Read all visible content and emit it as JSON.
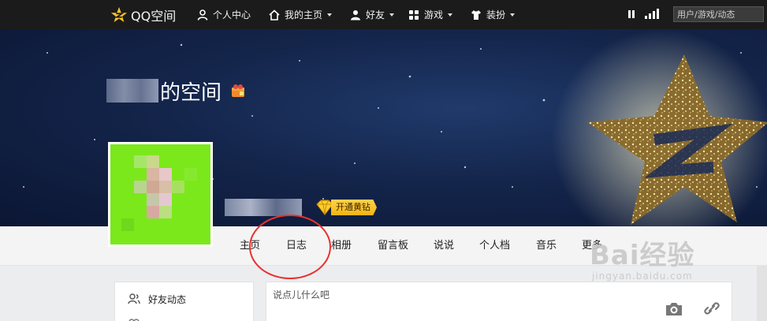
{
  "topbar": {
    "logo_text": "QQ空间",
    "nav": [
      {
        "label": "个人中心",
        "icon": "person-icon",
        "has_caret": false
      },
      {
        "label": "我的主页",
        "icon": "home-icon",
        "has_caret": true
      },
      {
        "label": "好友",
        "icon": "friends-icon",
        "has_caret": true
      },
      {
        "label": "游戏",
        "icon": "grid-icon",
        "has_caret": true
      },
      {
        "label": "装扮",
        "icon": "shirt-icon",
        "has_caret": true
      }
    ],
    "search_placeholder": "用户/游戏/动态"
  },
  "banner": {
    "title_suffix": "的空间",
    "vip_button_label": "开通黄钻"
  },
  "main_nav": {
    "tabs": [
      "主页",
      "日志",
      "相册",
      "留言板",
      "说说",
      "个人档",
      "音乐",
      "更多"
    ],
    "highlighted_tab": "日志"
  },
  "sidebar": {
    "items": [
      {
        "label": "好友动态",
        "icon": "friends-feed-icon"
      }
    ]
  },
  "composer": {
    "placeholder": "说点儿什么吧",
    "tools": [
      "camera-icon",
      "link-icon"
    ]
  },
  "watermark": {
    "main": "Bai经验",
    "sub": "jingyan.baidu.com"
  },
  "colors": {
    "topbar_bg": "#1b1b1b",
    "banner_bg": "#14254b",
    "avatar_green": "#7be81b",
    "vip_gold": "#f2b315",
    "annotation_red": "#e8322e"
  }
}
